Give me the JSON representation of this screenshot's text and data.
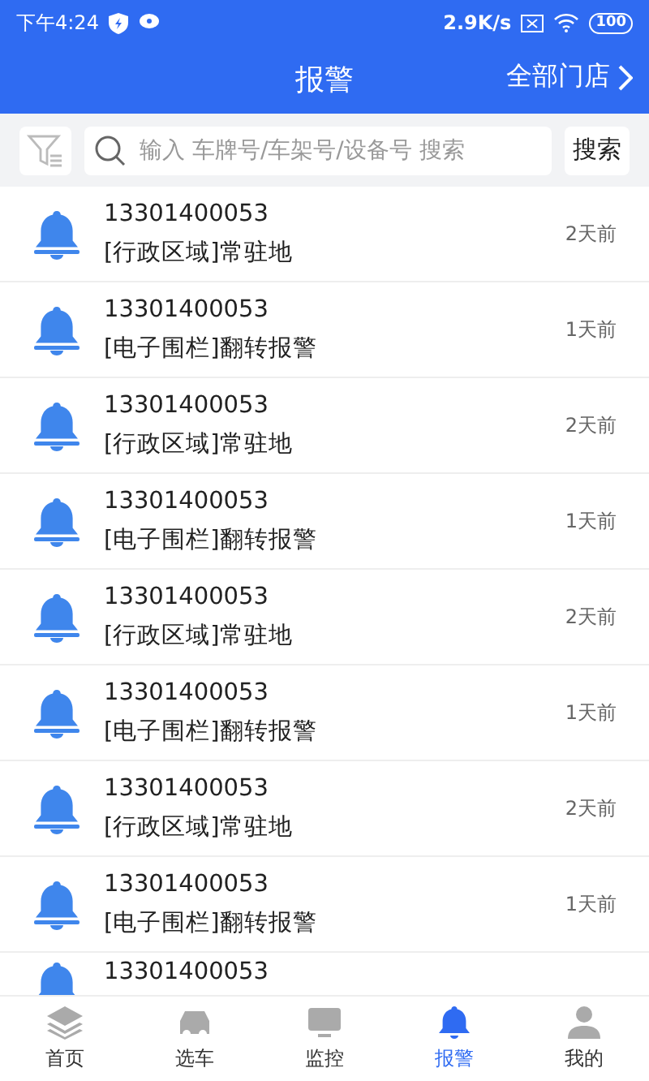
{
  "status_bar": {
    "time": "下午4:24",
    "speed": "2.9K/s",
    "battery": "100"
  },
  "header": {
    "title": "报警",
    "store_filter": "全部门店"
  },
  "search": {
    "placeholder": "输入 车牌号/车架号/设备号 搜索",
    "button": "搜索"
  },
  "alarms": [
    {
      "number": "13301400053",
      "type": "[行政区域]常驻地",
      "time": "2天前"
    },
    {
      "number": "13301400053",
      "type": "[电子围栏]翻转报警",
      "time": "1天前"
    },
    {
      "number": "13301400053",
      "type": "[行政区域]常驻地",
      "time": "2天前"
    },
    {
      "number": "13301400053",
      "type": "[电子围栏]翻转报警",
      "time": "1天前"
    },
    {
      "number": "13301400053",
      "type": "[行政区域]常驻地",
      "time": "2天前"
    },
    {
      "number": "13301400053",
      "type": "[电子围栏]翻转报警",
      "time": "1天前"
    },
    {
      "number": "13301400053",
      "type": "[行政区域]常驻地",
      "time": "2天前"
    },
    {
      "number": "13301400053",
      "type": "[电子围栏]翻转报警",
      "time": "1天前"
    },
    {
      "number": "13301400053"
    }
  ],
  "tabs": [
    {
      "label": "首页",
      "selected": false
    },
    {
      "label": "选车",
      "selected": false
    },
    {
      "label": "监控",
      "selected": false
    },
    {
      "label": "报警",
      "selected": true
    },
    {
      "label": "我的",
      "selected": false
    }
  ]
}
